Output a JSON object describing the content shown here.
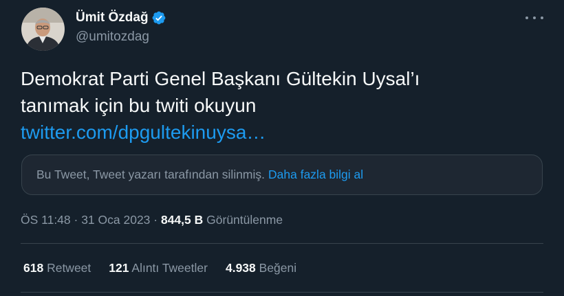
{
  "author": {
    "display_name": "Ümit Özdağ",
    "handle": "@umitozdag",
    "verified": true,
    "avatar": "profile-photo"
  },
  "tweet": {
    "text_line1": "Demokrat Parti Genel Başkanı Gültekin Uysal’ı",
    "text_line2": "tanımak için bu twiti okuyun",
    "link_text": "twitter.com/dpgultekinuysa…"
  },
  "quoted_tweet": {
    "notice": "Bu Tweet, Tweet yazarı tarafından silinmiş.",
    "learn_more": "Daha fazla bilgi al"
  },
  "meta": {
    "time": "ÖS 11:48",
    "separator": " · ",
    "date": "31 Oca 2023",
    "views_count": "844,5 B",
    "views_label": "Görüntülenme"
  },
  "stats": {
    "retweets_count": "618",
    "retweets_label": "Retweet",
    "quotes_count": "121",
    "quotes_label": "Alıntı Tweetler",
    "likes_count": "4.938",
    "likes_label": "Beğeni"
  },
  "colors": {
    "background": "#15202b",
    "text": "#f7f9f9",
    "secondary_text": "#8b98a5",
    "accent": "#1d9bf0",
    "border": "#38444d"
  },
  "icons": {
    "verified": "verified-badge-icon",
    "more": "more-options-icon"
  }
}
